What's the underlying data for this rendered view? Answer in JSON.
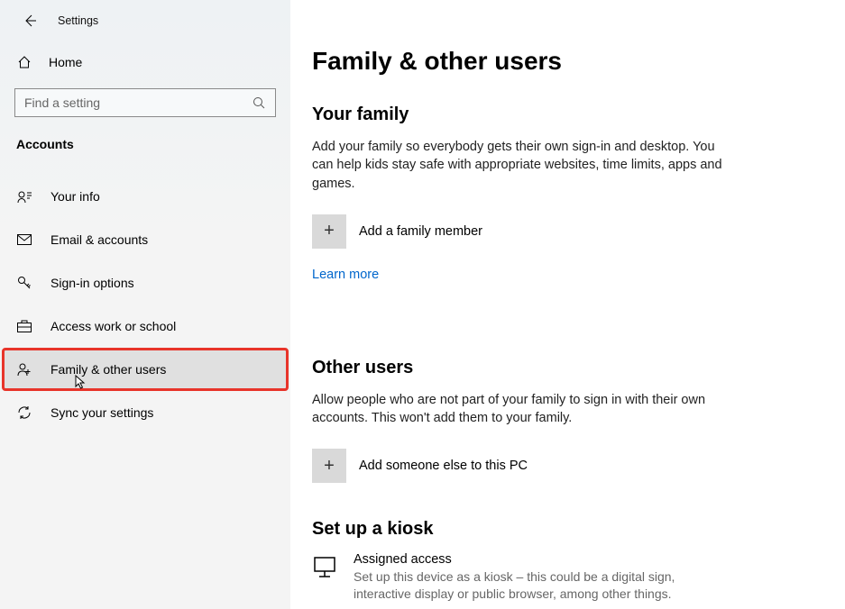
{
  "header": {
    "app_title": "Settings"
  },
  "sidebar": {
    "home_label": "Home",
    "search_placeholder": "Find a setting",
    "section_title": "Accounts",
    "items": [
      {
        "label": "Your info"
      },
      {
        "label": "Email & accounts"
      },
      {
        "label": "Sign-in options"
      },
      {
        "label": "Access work or school"
      },
      {
        "label": "Family & other users"
      },
      {
        "label": "Sync your settings"
      }
    ]
  },
  "main": {
    "title": "Family & other users",
    "family": {
      "heading": "Your family",
      "body": "Add your family so everybody gets their own sign-in and desktop. You can help kids stay safe with appropriate websites, time limits, apps and games.",
      "add_label": "Add a family member",
      "learn_more": "Learn more"
    },
    "other": {
      "heading": "Other users",
      "body": "Allow people who are not part of your family to sign in with their own accounts. This won't add them to your family.",
      "add_label": "Add someone else to this PC"
    },
    "kiosk": {
      "heading": "Set up a kiosk",
      "title": "Assigned access",
      "desc": "Set up this device as a kiosk – this could be a digital sign, interactive display or public browser, among other things."
    }
  }
}
